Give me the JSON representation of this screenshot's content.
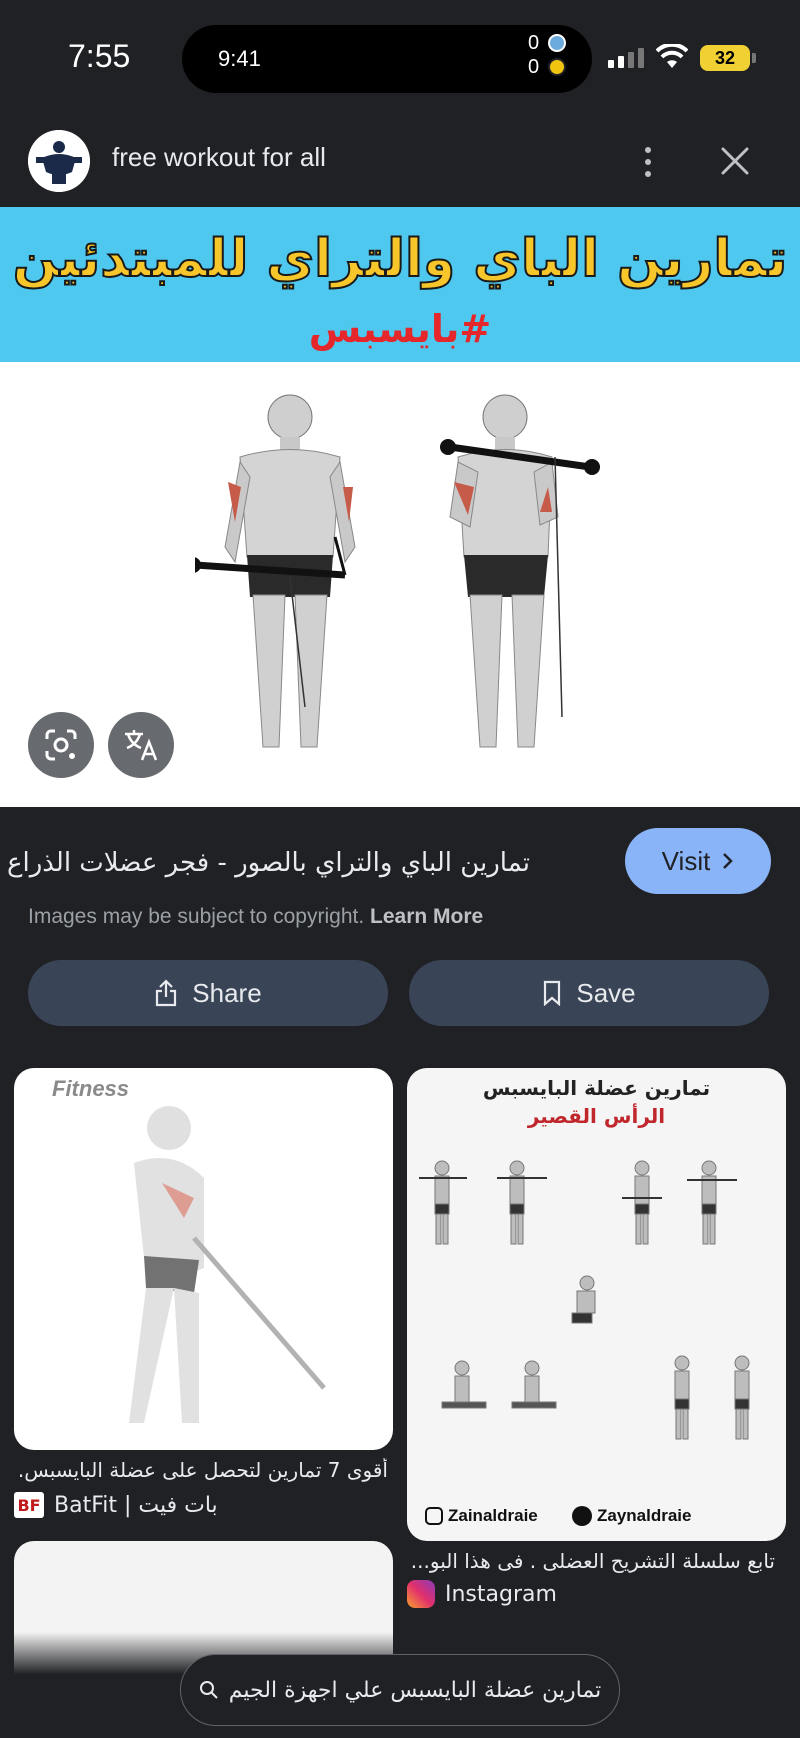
{
  "status_bar": {
    "time": "7:55",
    "island_time": "9:41",
    "score_top": "0",
    "score_bottom": "0",
    "battery": "32"
  },
  "header": {
    "site_title": "free workout for all"
  },
  "hero": {
    "banner_title": "تمارين الباي والتراي للمبتدئين",
    "banner_tag": "#بايسبس"
  },
  "details": {
    "caption": "تمارين الباي والتراي بالصور - فجر عضلات الذراع",
    "visit_label": "Visit",
    "copyright_text": "Images may be subject to copyright.",
    "learn_more": "Learn More",
    "share_label": "Share",
    "save_label": "Save"
  },
  "related": [
    {
      "logo_text": "Fitness",
      "caption": "أقوى 7 تمارين لتحصل على عضلة البايسبس...",
      "source": "BatFit | بات فيت",
      "source_icon": "BF"
    },
    {
      "title": "تمارين عضلة البايسبس",
      "subtitle": "الرأس القصير",
      "footer_left": "Zainaldraie",
      "footer_right": "Zaynaldraie",
      "caption": "تابع سلسلة التشريح العضلى . فى هذا البو...",
      "source": "Instagram"
    }
  ],
  "search": {
    "query": "تمارين عضلة البايسبس علي اجهزة الجيم"
  },
  "colors": {
    "accent": "#8ab4f8",
    "button_bg": "#394457",
    "banner": "#4fc8ef",
    "banner_text": "#f7c62a",
    "tag": "#e5272b"
  }
}
